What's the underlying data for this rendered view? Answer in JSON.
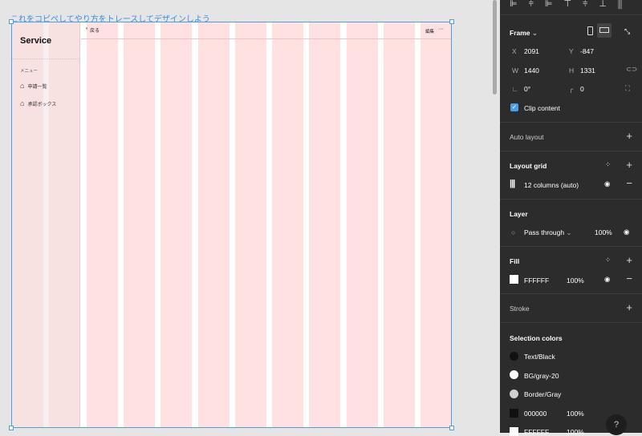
{
  "canvas": {
    "caption": "これをコピペしてやり方をトレースしてデザインしよう"
  },
  "frame": {
    "logo": "Service",
    "back_label": "戻る",
    "edit_label": "編集",
    "more_label": "···",
    "menu_heading": "メニュー",
    "menu_items": [
      {
        "label": "申請一覧",
        "icon": "home-icon"
      },
      {
        "label": "承認ボックス",
        "icon": "home-icon"
      }
    ],
    "grid_color": "#ffe1e1"
  },
  "panel": {
    "frame_label": "Frame",
    "x_label": "X",
    "x": "2091",
    "y_label": "Y",
    "y": "-847",
    "w_label": "W",
    "w": "1440",
    "h_label": "H",
    "h": "1331",
    "rotation": "0°",
    "radius": "0",
    "clip_content": "Clip content",
    "auto_layout": "Auto layout",
    "layout_grid": "Layout grid",
    "grid_item": "12 columns (auto)",
    "layer": "Layer",
    "blend": "Pass through",
    "layer_opacity": "100%",
    "fill": "Fill",
    "fill_hex": "FFFFFF",
    "fill_opacity": "100%",
    "stroke": "Stroke",
    "selection_colors": "Selection colors",
    "colors": [
      {
        "name": "Text/Black",
        "color": "#111111"
      },
      {
        "name": "BG/gray-20",
        "color": "#ffffff"
      },
      {
        "name": "Border/Gray",
        "color": "#d0d0d0"
      }
    ],
    "hex_colors": [
      {
        "hex": "000000",
        "opacity": "100%",
        "color": "#111111"
      },
      {
        "hex": "FFFFFF",
        "opacity": "100%",
        "color": "#ffffff"
      }
    ],
    "help": "?"
  }
}
